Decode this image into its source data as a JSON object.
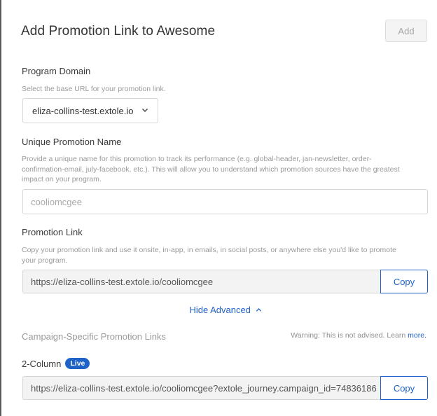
{
  "header": {
    "title": "Add Promotion Link to Awesome",
    "add_label": "Add"
  },
  "program_domain": {
    "label": "Program Domain",
    "help": "Select the base URL for your promotion link.",
    "selected": "eliza-collins-test.extole.io"
  },
  "promotion_name": {
    "label": "Unique Promotion Name",
    "help_line1": "Provide a unique name for this promotion to track its performance (e.g. global-header, jan-newsletter, order-",
    "help_line2": "confirmation-email, july-facebook, etc.). This will allow you to understand which promotion sources have the greatest",
    "help_line3": "impact on your program.",
    "value": "cooliomcgee"
  },
  "promotion_link": {
    "label": "Promotion Link",
    "help_line1": "Copy your promotion link and use it onsite, in-app, in emails, in social posts, or anywhere else you'd like to promote",
    "help_line2": "your program.",
    "url": "https://eliza-collins-test.extole.io/cooliomcgee",
    "copy_label": "Copy"
  },
  "advanced": {
    "toggle_label": "Hide Advanced",
    "section_label": "Campaign-Specific Promotion Links",
    "warning_text": "Warning: This is not advised. Learn ",
    "warning_link": "more."
  },
  "campaign": {
    "name": "2-Column",
    "badge": "Live",
    "url": "https://eliza-collins-test.extole.io/cooliomcgee?extole_journey.campaign_id=74836186",
    "copy_label": "Copy"
  },
  "colors": {
    "accent": "#1f62c8",
    "muted_text": "#9b9b9b"
  },
  "icons": {
    "select_chevron": "chevron-down-icon",
    "advanced_caret": "chevron-up-icon"
  }
}
